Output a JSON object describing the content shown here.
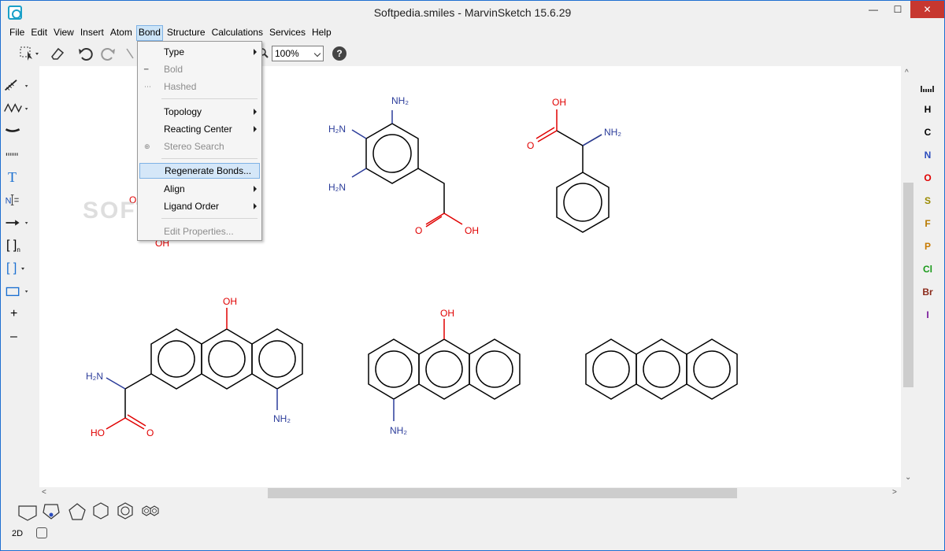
{
  "window": {
    "title": "Softpedia.smiles - MarvinSketch 15.6.29",
    "controls": {
      "minimize": "—",
      "maximize": "☐",
      "close": "✕"
    }
  },
  "menubar": {
    "items": [
      "File",
      "Edit",
      "View",
      "Insert",
      "Atom",
      "Bond",
      "Structure",
      "Calculations",
      "Services",
      "Help"
    ],
    "active": "Bond"
  },
  "toolbar": {
    "zoom": "100%",
    "help": "?",
    "icons": [
      "selection-icon",
      "eraser-icon",
      "undo-icon",
      "redo-icon",
      "scissors-icon",
      "zoom-icon",
      "help-icon"
    ]
  },
  "bond_menu": {
    "items": [
      {
        "label": "Type",
        "submenu": true,
        "disabled": false
      },
      {
        "label": "Bold",
        "submenu": false,
        "disabled": true
      },
      {
        "label": "Hashed",
        "submenu": false,
        "disabled": true
      },
      {
        "label": "Topology",
        "submenu": true,
        "disabled": false
      },
      {
        "label": "Reacting Center",
        "submenu": true,
        "disabled": false
      },
      {
        "label": "Stereo Search",
        "submenu": false,
        "disabled": true
      },
      {
        "label": "Regenerate Bonds...",
        "submenu": false,
        "disabled": false,
        "highlighted": true
      },
      {
        "label": "Align",
        "submenu": true,
        "disabled": false
      },
      {
        "label": "Ligand Order",
        "submenu": true,
        "disabled": false
      },
      {
        "label": "Edit Properties...",
        "submenu": false,
        "disabled": true
      }
    ]
  },
  "left_tools": [
    "single-bond-icon",
    "chain-icon",
    "bold-bond-icon",
    "hashed-bond-icon",
    "text-icon",
    "atom-label-icon",
    "arrow-icon",
    "bracket-n-icon",
    "bracket-icon",
    "rectangle-icon",
    "plus-icon",
    "minus-icon"
  ],
  "left_tool_labels": {
    "text": "T",
    "plus": "+",
    "minus": "–",
    "bracket": "[ ]",
    "bracket_n": "[ ]",
    "bracket_sub": "n"
  },
  "elements": [
    {
      "symbol": "H",
      "color": "#000000"
    },
    {
      "symbol": "C",
      "color": "#000000"
    },
    {
      "symbol": "N",
      "color": "#2b4cbd"
    },
    {
      "symbol": "O",
      "color": "#e00000"
    },
    {
      "symbol": "S",
      "color": "#9a8a00"
    },
    {
      "symbol": "F",
      "color": "#b87a00"
    },
    {
      "symbol": "P",
      "color": "#c87a00"
    },
    {
      "symbol": "Cl",
      "color": "#1a9a1a"
    },
    {
      "symbol": "Br",
      "color": "#8b2a1a"
    },
    {
      "symbol": "I",
      "color": "#7a1a9a"
    }
  ],
  "bottom_templates": [
    "pentagon-open-icon",
    "pyrrole-icon",
    "cyclopentane-icon",
    "cyclohexane-icon",
    "benzene-icon",
    "naphthalene-icon"
  ],
  "status": {
    "mode": "2D"
  },
  "canvas": {
    "watermark": "SOFTPEDIA",
    "labels": {
      "nh2": "NH₂",
      "h2n": "H₂N",
      "oh": "OH",
      "o": "O",
      "ho": "HO"
    },
    "colors": {
      "nitrogen": "#2b3c9a",
      "oxygen": "#e00000",
      "bond": "#000000"
    }
  }
}
